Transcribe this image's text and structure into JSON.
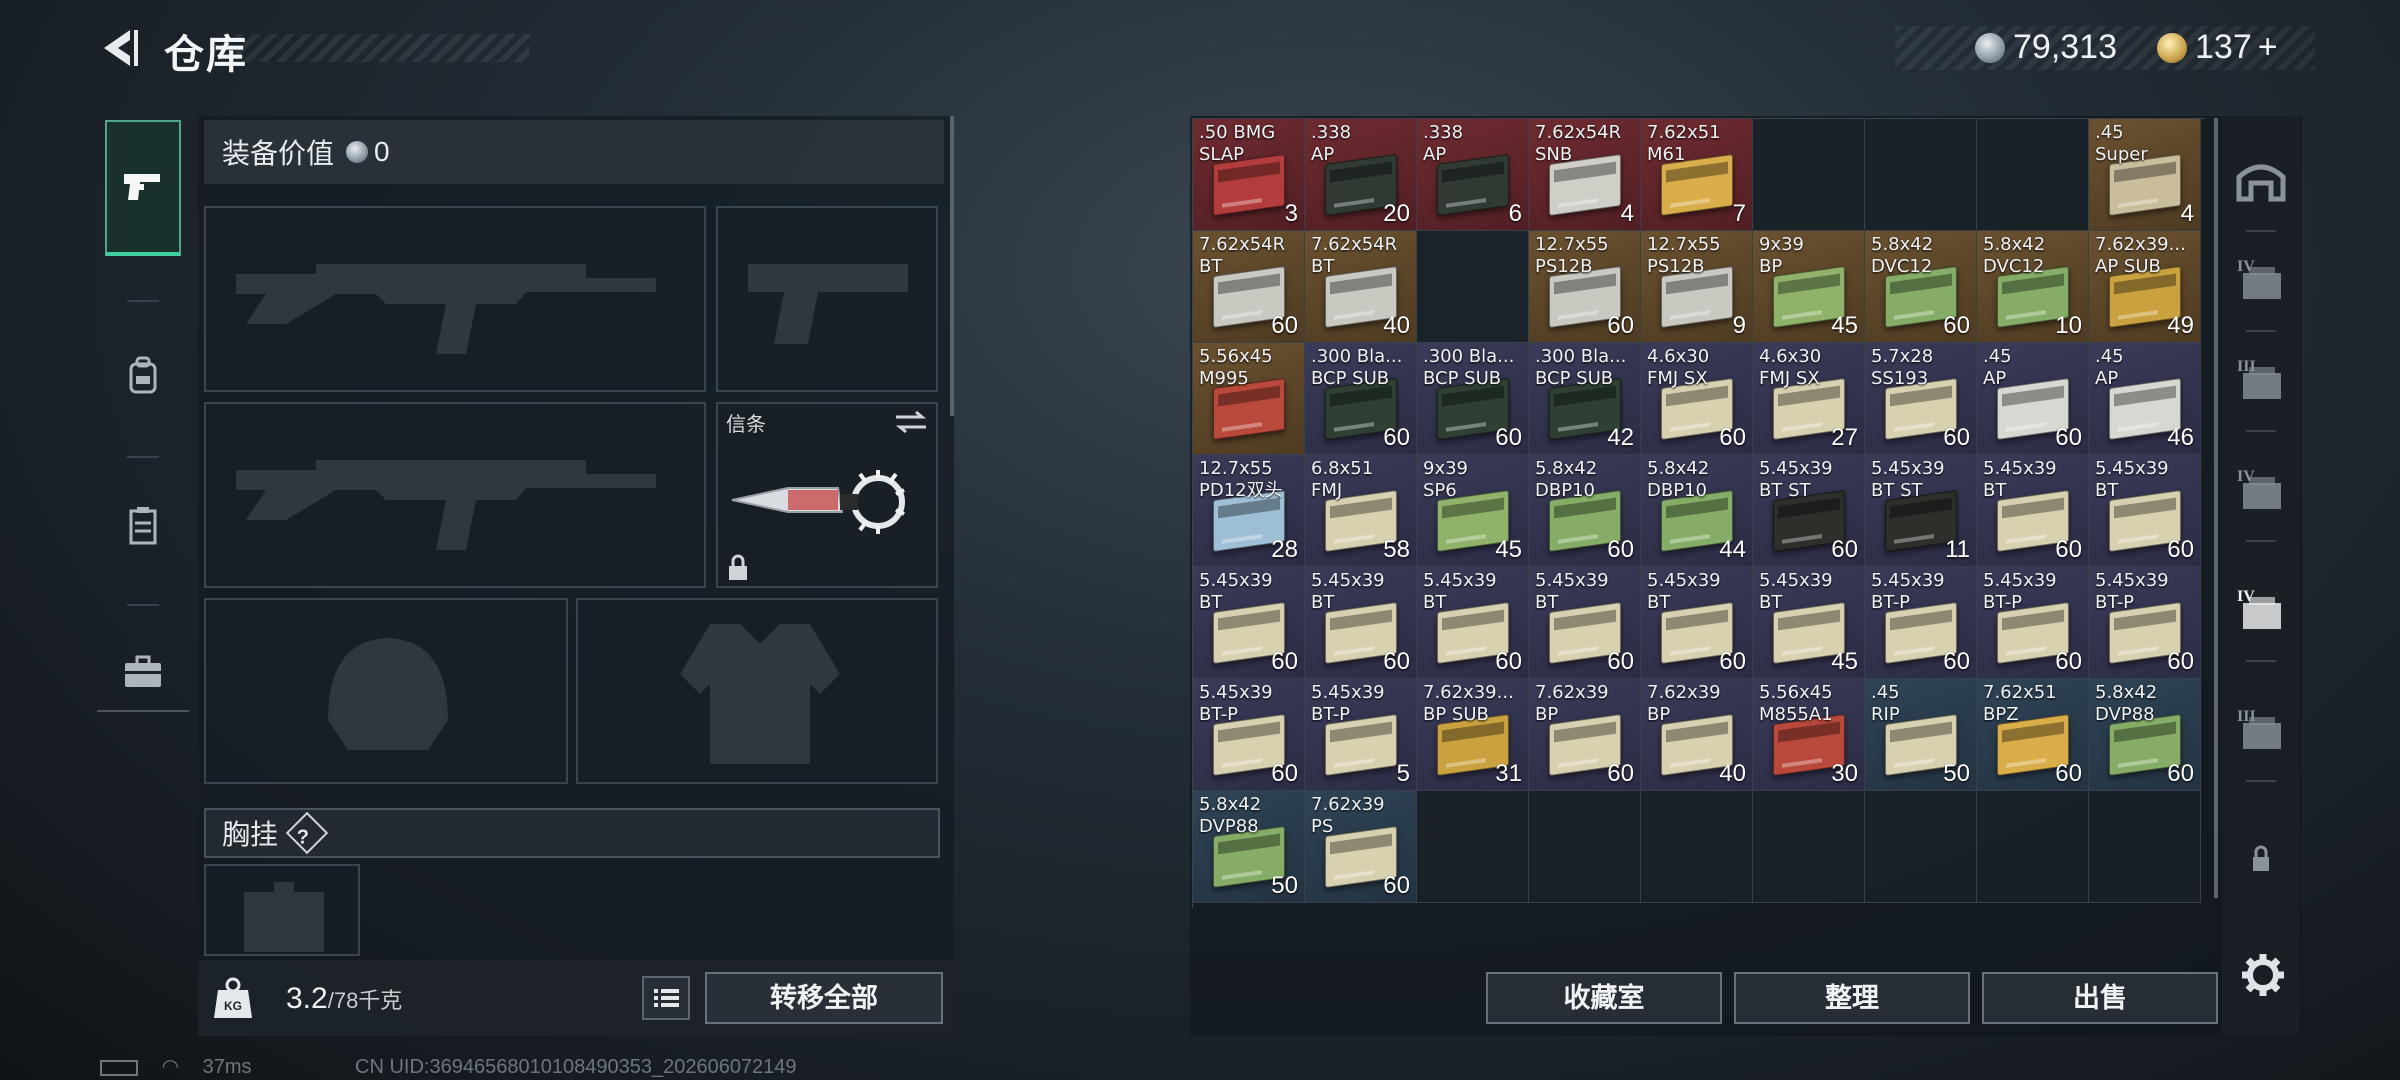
{
  "header": {
    "title": "仓库",
    "currency_silver": "79,313",
    "currency_gold": "137",
    "currency_gold_plus": "+"
  },
  "loadout": {
    "equip_value_label": "装备价值",
    "equip_value": "0",
    "letter_slot_label": "信条",
    "chest_rig_label": "胸挂",
    "chest_rig_help": "?",
    "weight_current": "3.2",
    "weight_max": "/78千克",
    "weight_icon_text": "KG",
    "transfer_all": "转移全部"
  },
  "storage": {
    "items": [
      {
        "name": ".50 BMG\nSLAP",
        "qty": "3",
        "rarity": "red",
        "box": "#b33d3d"
      },
      {
        "name": ".338\nAP",
        "qty": "20",
        "rarity": "red",
        "box": "#2f3a33"
      },
      {
        "name": ".338\nAP",
        "qty": "6",
        "rarity": "red",
        "box": "#2f3a33"
      },
      {
        "name": "7.62x54R\nSNB",
        "qty": "4",
        "rarity": "red",
        "box": "#cfcfc8"
      },
      {
        "name": "7.62x51\nM61",
        "qty": "7",
        "rarity": "red",
        "box": "#d9ad4a"
      },
      {
        "name": "",
        "qty": "",
        "rarity": "empty"
      },
      {
        "name": "",
        "qty": "",
        "rarity": "empty"
      },
      {
        "name": "",
        "qty": "",
        "rarity": "empty"
      },
      {
        "name": ".45\nSuper",
        "qty": "4",
        "rarity": "gold",
        "box": "#c9bd9c"
      },
      {
        "name": "7.62x54R\nBT",
        "qty": "60",
        "rarity": "gold",
        "box": "#c9c9c2"
      },
      {
        "name": "7.62x54R\nBT",
        "qty": "40",
        "rarity": "gold",
        "box": "#c9c9c2"
      },
      {
        "name": "",
        "qty": "",
        "rarity": "empty"
      },
      {
        "name": "12.7x55\nPS12B",
        "qty": "60",
        "rarity": "gold",
        "box": "#c9c9c2"
      },
      {
        "name": "12.7x55\nPS12B",
        "qty": "9",
        "rarity": "gold",
        "box": "#c9c9c2"
      },
      {
        "name": "9x39\nBP",
        "qty": "45",
        "rarity": "gold",
        "box": "#8fb36a"
      },
      {
        "name": "5.8x42\nDVC12",
        "qty": "60",
        "rarity": "gold",
        "box": "#86ad67"
      },
      {
        "name": "5.8x42\nDVC12",
        "qty": "10",
        "rarity": "gold",
        "box": "#86ad67"
      },
      {
        "name": "7.62x39...\nAP SUB",
        "qty": "49",
        "rarity": "gold",
        "box": "#c9a23f"
      },
      {
        "name": "5.56x45\nM995",
        "qty": "",
        "rarity": "gold",
        "box": "#b9493b"
      },
      {
        "name": ".300 Bla...\nBCP SUB",
        "qty": "60",
        "rarity": "purple",
        "box": "#2f3f33"
      },
      {
        "name": ".300 Bla...\nBCP SUB",
        "qty": "60",
        "rarity": "purple",
        "box": "#2f3f33"
      },
      {
        "name": ".300 Bla...\nBCP SUB",
        "qty": "42",
        "rarity": "purple",
        "box": "#2f3f33"
      },
      {
        "name": "4.6x30\nFMJ SX",
        "qty": "60",
        "rarity": "purple",
        "box": "#d8d1b0"
      },
      {
        "name": "4.6x30\nFMJ SX",
        "qty": "27",
        "rarity": "purple",
        "box": "#d8d1b0"
      },
      {
        "name": "5.7x28\nSS193",
        "qty": "60",
        "rarity": "purple",
        "box": "#d8d1b0"
      },
      {
        "name": ".45\nAP",
        "qty": "60",
        "rarity": "purple",
        "box": "#d8d8d2"
      },
      {
        "name": ".45\nAP",
        "qty": "46",
        "rarity": "purple",
        "box": "#d8d8d2"
      },
      {
        "name": "12.7x55\nPD12双头",
        "qty": "28",
        "rarity": "purple",
        "box": "#9fbfd6"
      },
      {
        "name": "6.8x51\nFMJ",
        "qty": "58",
        "rarity": "purple",
        "box": "#d8d1b0"
      },
      {
        "name": "9x39\nSP6",
        "qty": "45",
        "rarity": "purple",
        "box": "#8fb36a"
      },
      {
        "name": "5.8x42\nDBP10",
        "qty": "60",
        "rarity": "purple",
        "box": "#86ad67"
      },
      {
        "name": "5.8x42\nDBP10",
        "qty": "44",
        "rarity": "purple",
        "box": "#86ad67"
      },
      {
        "name": "5.45x39\nBT ST",
        "qty": "60",
        "rarity": "purple",
        "box": "#2d2f2a"
      },
      {
        "name": "5.45x39\nBT ST",
        "qty": "11",
        "rarity": "purple",
        "box": "#2d2f2a"
      },
      {
        "name": "5.45x39\nBT",
        "qty": "60",
        "rarity": "purple",
        "box": "#d8d1b0"
      },
      {
        "name": "5.45x39\nBT",
        "qty": "60",
        "rarity": "purple",
        "box": "#d8d1b0"
      },
      {
        "name": "5.45x39\nBT",
        "qty": "60",
        "rarity": "purple",
        "box": "#d8d1b0"
      },
      {
        "name": "5.45x39\nBT",
        "qty": "60",
        "rarity": "purple",
        "box": "#d8d1b0"
      },
      {
        "name": "5.45x39\nBT",
        "qty": "60",
        "rarity": "purple",
        "box": "#d8d1b0"
      },
      {
        "name": "5.45x39\nBT",
        "qty": "60",
        "rarity": "purple",
        "box": "#d8d1b0"
      },
      {
        "name": "5.45x39\nBT",
        "qty": "60",
        "rarity": "purple",
        "box": "#d8d1b0"
      },
      {
        "name": "5.45x39\nBT",
        "qty": "45",
        "rarity": "purple",
        "box": "#d8d1b0"
      },
      {
        "name": "5.45x39\nBT-P",
        "qty": "60",
        "rarity": "purple",
        "box": "#d8d1b0"
      },
      {
        "name": "5.45x39\nBT-P",
        "qty": "60",
        "rarity": "purple",
        "box": "#d8d1b0"
      },
      {
        "name": "5.45x39\nBT-P",
        "qty": "60",
        "rarity": "purple",
        "box": "#d8d1b0"
      },
      {
        "name": "5.45x39\nBT-P",
        "qty": "60",
        "rarity": "purple",
        "box": "#d8d1b0"
      },
      {
        "name": "5.45x39\nBT-P",
        "qty": "5",
        "rarity": "purple",
        "box": "#d8d1b0"
      },
      {
        "name": "7.62x39...\nBP SUB",
        "qty": "31",
        "rarity": "purple",
        "box": "#c9a23f"
      },
      {
        "name": "7.62x39\nBP",
        "qty": "60",
        "rarity": "purple",
        "box": "#d8d1b0"
      },
      {
        "name": "7.62x39\nBP",
        "qty": "40",
        "rarity": "purple",
        "box": "#d8d1b0"
      },
      {
        "name": "5.56x45\nM855A1",
        "qty": "30",
        "rarity": "purple",
        "box": "#b9493b"
      },
      {
        "name": ".45\nRIP",
        "qty": "50",
        "rarity": "blue",
        "box": "#d8d1b0"
      },
      {
        "name": "7.62x51\nBPZ",
        "qty": "60",
        "rarity": "blue",
        "box": "#d9ad4a"
      },
      {
        "name": "5.8x42\nDVP88",
        "qty": "60",
        "rarity": "blue",
        "box": "#86ad67"
      },
      {
        "name": "5.8x42\nDVP88",
        "qty": "50",
        "rarity": "blue",
        "box": "#86ad67"
      },
      {
        "name": "7.62x39\nPS",
        "qty": "60",
        "rarity": "blue",
        "box": "#d8d1b0"
      }
    ]
  },
  "actions": {
    "collection": "收藏室",
    "sort": "整理",
    "sell": "出售"
  },
  "right_tabs": [
    {
      "label": "bunker-icon",
      "roman": ""
    },
    {
      "label": "case-iv-icon",
      "roman": "IV"
    },
    {
      "label": "case-iii-icon",
      "roman": "III"
    },
    {
      "label": "case-iv-icon",
      "roman": "IV"
    },
    {
      "label": "case-iv-active-icon",
      "roman": "IV"
    },
    {
      "label": "case-iii-icon",
      "roman": "III"
    },
    {
      "label": "lock-icon",
      "roman": ""
    }
  ],
  "status_bar": {
    "ping": "37ms",
    "uid": "CN UID:36946568010108490353_202606072149"
  }
}
